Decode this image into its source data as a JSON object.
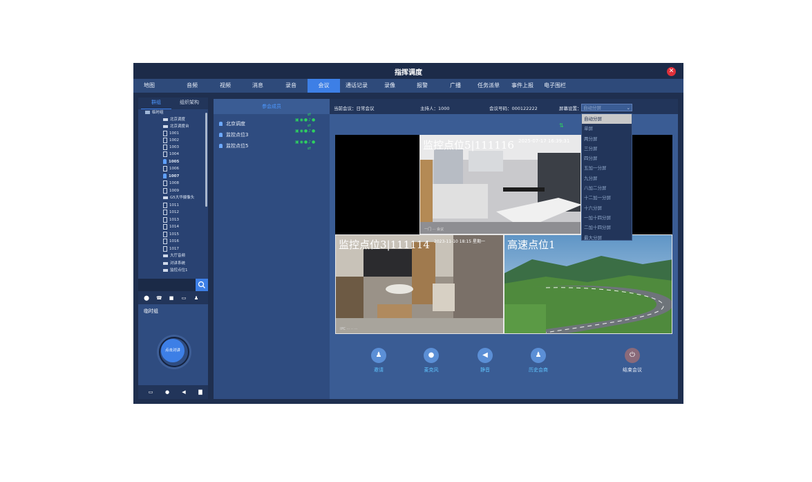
{
  "window": {
    "title": "指挥调度"
  },
  "menu": [
    "地图",
    "音频",
    "视频",
    "消息",
    "录音",
    "会议",
    "通话记录",
    "录像",
    "报警",
    "广播",
    "任务派单",
    "事件上报",
    "电子围栏"
  ],
  "menu_active": "会议",
  "left_tabs": [
    "群组",
    "组织架构"
  ],
  "tree": [
    {
      "label": "临时组",
      "icon": "folder",
      "bold": false
    },
    {
      "label": "北京调度",
      "icon": "dispatcher",
      "bold": false
    },
    {
      "label": "北京调度台",
      "icon": "dispatcher",
      "bold": false
    },
    {
      "label": "1001",
      "icon": "phone",
      "bold": false
    },
    {
      "label": "1002",
      "icon": "phone",
      "bold": false
    },
    {
      "label": "1003",
      "icon": "phone",
      "bold": false
    },
    {
      "label": "1004",
      "icon": "phone",
      "bold": false
    },
    {
      "label": "1005",
      "icon": "person",
      "bold": true
    },
    {
      "label": "1006",
      "icon": "phone",
      "bold": false
    },
    {
      "label": "1007",
      "icon": "person",
      "bold": true
    },
    {
      "label": "1008",
      "icon": "phone",
      "bold": false
    },
    {
      "label": "1009",
      "icon": "phone",
      "bold": false
    },
    {
      "label": "G5大华摄像头",
      "icon": "camera",
      "bold": false
    },
    {
      "label": "1011",
      "icon": "phone",
      "bold": false
    },
    {
      "label": "1012",
      "icon": "phone",
      "bold": false
    },
    {
      "label": "1013",
      "icon": "phone",
      "bold": false
    },
    {
      "label": "1014",
      "icon": "phone",
      "bold": false
    },
    {
      "label": "1015",
      "icon": "phone",
      "bold": false
    },
    {
      "label": "1016",
      "icon": "phone",
      "bold": false
    },
    {
      "label": "1017",
      "icon": "phone",
      "bold": false
    },
    {
      "label": "大厅音频",
      "icon": "camera",
      "bold": false
    },
    {
      "label": "对讲系统",
      "icon": "camera",
      "bold": false
    },
    {
      "label": "监控点位1",
      "icon": "camera",
      "bold": false
    }
  ],
  "temp_group": {
    "label": "临时组",
    "ptt_label": "点击对讲"
  },
  "members": {
    "header": "参会成员",
    "items": [
      "北京调度",
      "监控点位3",
      "监控点位5"
    ]
  },
  "conference": {
    "current": "当前会议：日常会议",
    "host": "主持人：1000",
    "number": "会议号码：000122222",
    "screen_label": "屏幕设置：",
    "screen_value": "自动分屏"
  },
  "screen_options": [
    "自动分屏",
    "单屏",
    "两分屏",
    "三分屏",
    "四分屏",
    "五加一分屏",
    "九分屏",
    "八加二分屏",
    "十二加一分屏",
    "十六分屏",
    "一加十四分屏",
    "二加十四分屏",
    "最大分屏"
  ],
  "cameras": [
    {
      "label": "监控点位5|111116",
      "timestamp": "2025-07-17 16:39:31",
      "bottom": "一门 ··· 会议"
    },
    {
      "label": "监控点位3|111114",
      "timestamp": "2023-11-10 18:15 星期一",
      "bottom": "IPC ··· ·· ···"
    },
    {
      "label": "高速点位1",
      "timestamp": "",
      "bottom": ""
    }
  ],
  "actions": [
    {
      "label": "邀请",
      "icon": "invite-icon"
    },
    {
      "label": "麦克风",
      "icon": "microphone-icon"
    },
    {
      "label": "静音",
      "icon": "mute-icon"
    },
    {
      "label": "历史会商",
      "icon": "history-icon"
    },
    {
      "label": "结束会议",
      "icon": "power-icon"
    }
  ]
}
